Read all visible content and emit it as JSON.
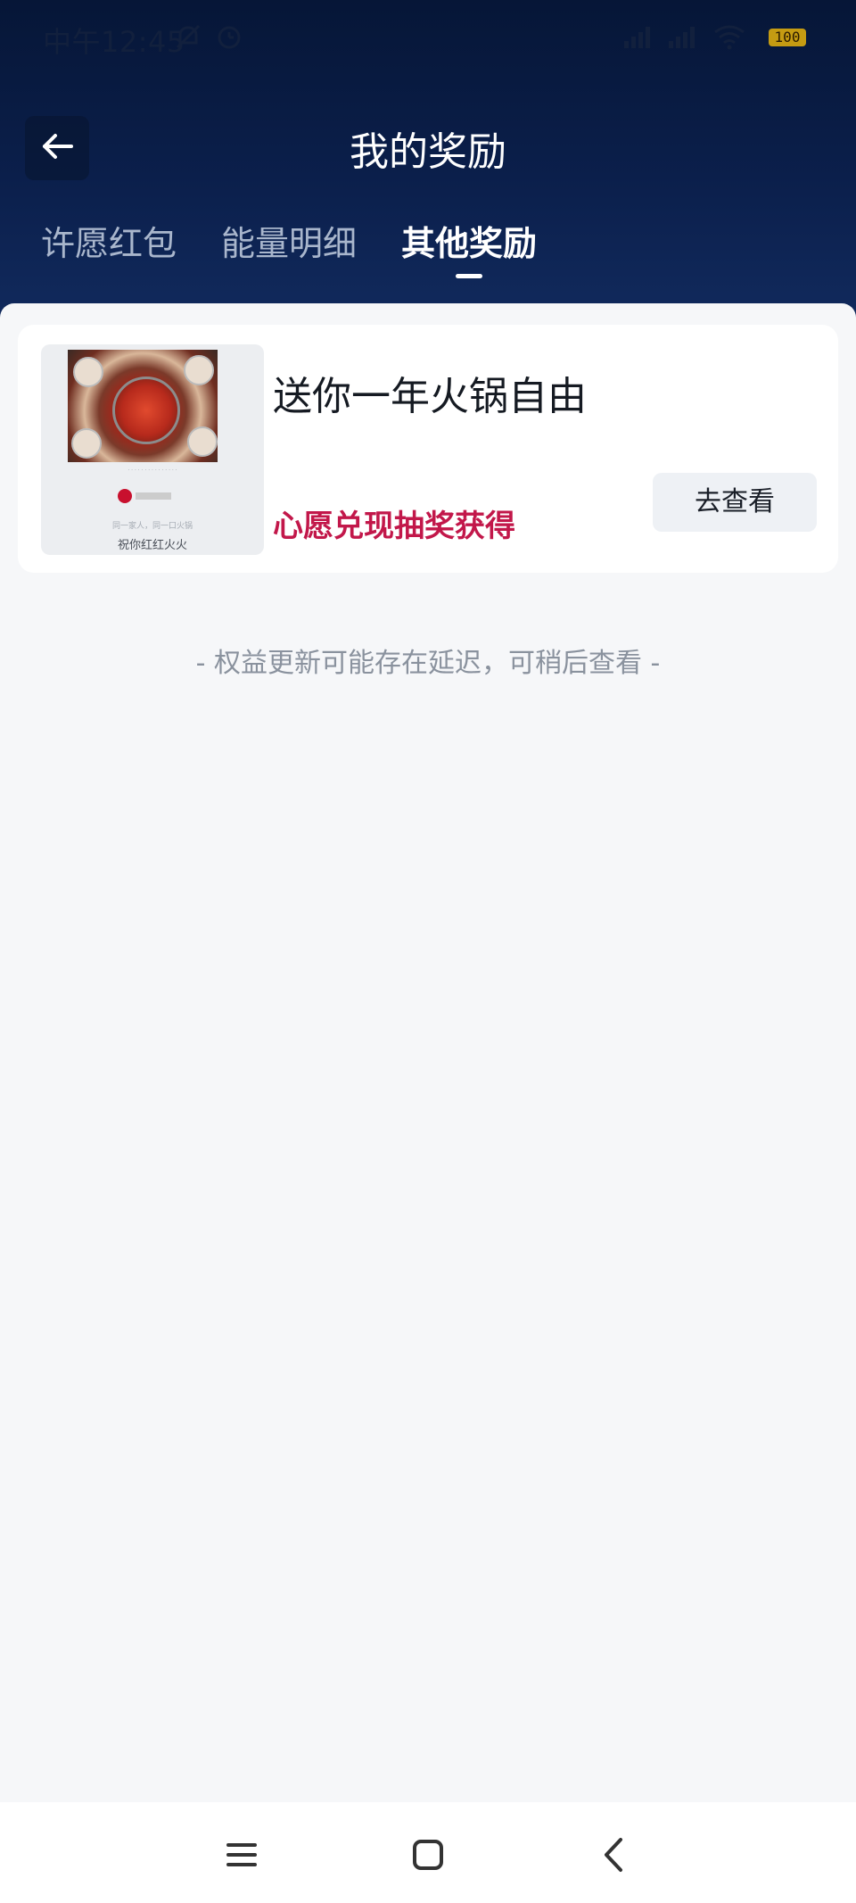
{
  "status_bar": {
    "time": "中午12:45",
    "battery": "100",
    "icons": [
      "notification-off-icon",
      "alarm-icon",
      "signal-hd-icon",
      "signal-hd-icon",
      "wifi-icon",
      "battery-icon"
    ]
  },
  "header": {
    "title": "我的奖励",
    "back_icon": "arrow-left-icon"
  },
  "tabs": [
    {
      "label": "许愿红包",
      "active": false
    },
    {
      "label": "能量明细",
      "active": false
    },
    {
      "label": "其他奖励",
      "active": true
    }
  ],
  "reward": {
    "title": "送你一年火锅自由",
    "source": "心愿兑现抽奖获得",
    "button_label": "去查看",
    "image": {
      "caption_line": "同一家人，同一口火锅",
      "tagline": "祝你红红火火"
    }
  },
  "notice": "- 权益更新可能存在延迟，可稍后查看 -",
  "nav_bar": {
    "icons": [
      "menu-icon",
      "home-square-icon",
      "back-chevron-icon"
    ]
  },
  "colors": {
    "header_dark": "#061637",
    "accent_red": "#c2174a",
    "page_bg": "#f6f7f9"
  }
}
